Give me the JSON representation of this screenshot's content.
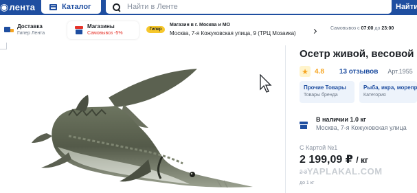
{
  "header": {
    "logo_text": "лента",
    "catalog_label": "Каталог",
    "search_placeholder": "Найти в Ленте",
    "find_label": "Найти"
  },
  "delivery": {
    "option1_title": "Доставка",
    "option1_sub": "Гипер Лента",
    "option2_title": "Магазины",
    "option2_sub": "Самовывоз -5%"
  },
  "store": {
    "badge": "Гипер",
    "title": "Магазин в г. Москва и МО",
    "address": "Москва, 7-я Кожуховская улица, 9 (ТРЦ Мозаика)",
    "pickup_prefix": "Самовывоз с",
    "pickup_from": "07:00",
    "pickup_mid": "до",
    "pickup_to": "23:00"
  },
  "product": {
    "title": "Осетр живой, весовой",
    "rating": "4.8",
    "reviews": "13 отзывов",
    "article": "Арт.1955",
    "categories": [
      {
        "title": "Прочие Товары",
        "sub": "Товары бренда"
      },
      {
        "title": "Рыба, икра, морепр",
        "sub": "Категория"
      }
    ],
    "availability": "В наличии 1.0 кг",
    "availability_address": "Москва, 7-я Кожуховская улица",
    "card_label": "С Картой №1",
    "price": "2 199,09 ₽",
    "price_unit": "/ кг",
    "old_price": "2 3",
    "per_kg": "до 1 кг",
    "watermark": "YAPLAKAL.COM"
  },
  "colors": {
    "brand_blue": "#1f4ea0",
    "accent_yellow": "#f6c72b",
    "star_orange": "#f6a521",
    "discount_red": "#e5332a"
  }
}
